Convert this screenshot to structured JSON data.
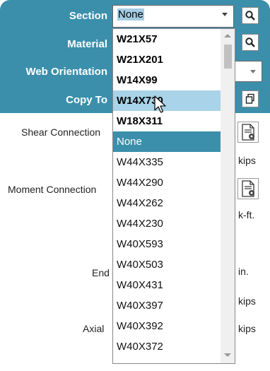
{
  "form": {
    "section_label": "Section",
    "material_label": "Material",
    "web_orientation_label": "Web Orientation",
    "copy_to_label": "Copy To",
    "section_value": "None",
    "shear_connection_label": "Shear Connection",
    "moment_connection_label": "Moment Connection",
    "end_label": "End",
    "axial_label": "Axial",
    "units": [
      "kips",
      "k-ft.",
      "in.",
      "kips",
      "kips"
    ]
  },
  "dropdown": {
    "items": [
      {
        "label": "W21X57",
        "state": "bold"
      },
      {
        "label": "W21X201",
        "state": "bold"
      },
      {
        "label": "W14X99",
        "state": "bold"
      },
      {
        "label": "W14X730",
        "state": "hover"
      },
      {
        "label": "W18X311",
        "state": "bold"
      },
      {
        "label": "None",
        "state": "selected"
      },
      {
        "label": "W44X335",
        "state": "normal"
      },
      {
        "label": "W44X290",
        "state": "normal"
      },
      {
        "label": "W44X262",
        "state": "normal"
      },
      {
        "label": "W44X230",
        "state": "normal"
      },
      {
        "label": "W40X593",
        "state": "normal"
      },
      {
        "label": "W40X503",
        "state": "normal"
      },
      {
        "label": "W40X431",
        "state": "normal"
      },
      {
        "label": "W40X397",
        "state": "normal"
      },
      {
        "label": "W40X392",
        "state": "normal"
      },
      {
        "label": "W40X372",
        "state": "normal"
      }
    ]
  },
  "colors": {
    "header": "#3b8fab",
    "selected": "#3b8fab",
    "hover": "#a8d3e8"
  },
  "icons": [
    "search-icon",
    "copy-icon",
    "document-settings-icon",
    "chevron-down-icon",
    "mouse-cursor-icon"
  ]
}
